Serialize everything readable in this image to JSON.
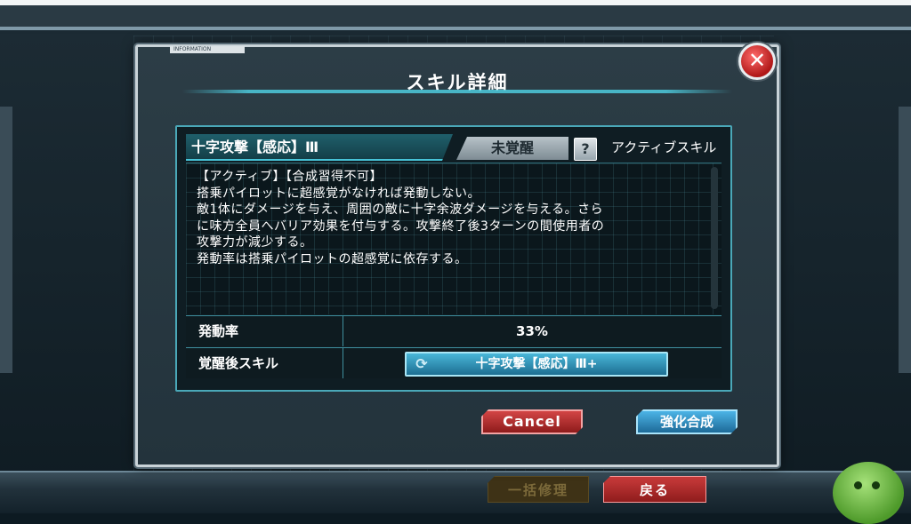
{
  "background": {
    "bulk_repair_label": "一括修理",
    "back_label": "戻る"
  },
  "modal": {
    "tab_label": "INFORMATION",
    "title": "スキル詳細",
    "close_glyph": "✕"
  },
  "skill": {
    "name": "十字攻撃【感応】Ⅲ",
    "awaken_status": "未覚醒",
    "help_glyph": "?",
    "type": "アクティブスキル",
    "description_lines": [
      "【アクティブ】【合成習得不可】",
      "搭乗パイロットに超感覚がなければ発動しない。",
      "敵1体にダメージを与え、周囲の敵に十字余波ダメージを与える。さら",
      "に味方全員へバリア効果を付与する。攻撃終了後3ターンの間使用者の",
      "攻撃力が減少する。",
      "発動率は搭乗パイロットの超感覚に依存する。"
    ],
    "activation_rate_label": "発動率",
    "activation_rate_value": "33%",
    "post_awaken_label": "覚醒後スキル",
    "post_awaken_skill": "十字攻撃【感応】Ⅲ+"
  },
  "actions": {
    "cancel_label": "Cancel",
    "synthesize_label": "強化合成"
  },
  "colors": {
    "accent_cyan": "#47c4d8",
    "cancel_red": "#d24545",
    "confirm_blue": "#4cb4e6"
  },
  "icons": {
    "close": "close-icon",
    "help": "question-icon",
    "refresh": "refresh-icon"
  }
}
